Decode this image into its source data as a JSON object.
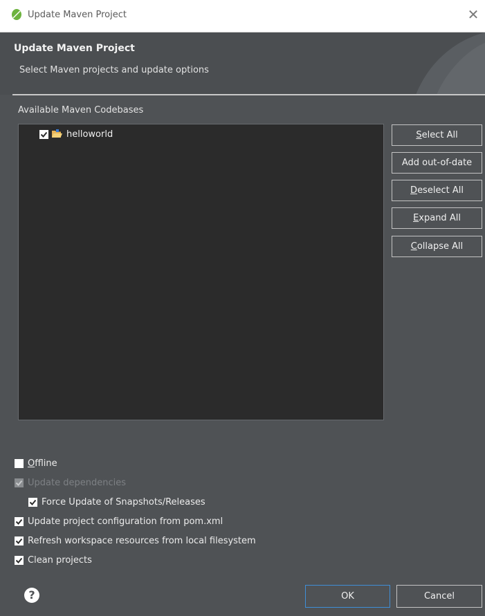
{
  "window": {
    "title": "Update Maven Project",
    "close_glyph": "✕"
  },
  "header": {
    "title": "Update Maven Project",
    "subtitle": "Select Maven projects and update options"
  },
  "codebases": {
    "label": "Available Maven Codebases",
    "items": [
      {
        "label": "helloworld",
        "checked": true
      }
    ]
  },
  "side_buttons": {
    "select_all": {
      "mnemonic": "S",
      "rest": "elect All"
    },
    "add_out_of_date": {
      "label": "Add out-of-date"
    },
    "deselect_all": {
      "mnemonic": "D",
      "rest": "eselect All"
    },
    "expand_all": {
      "mnemonic": "E",
      "rest": "xpand All"
    },
    "collapse_all": {
      "mnemonic": "C",
      "rest": "ollapse All"
    }
  },
  "options": {
    "offline": {
      "mnemonic": "O",
      "rest": "ffline",
      "checked": false
    },
    "update_dependencies": {
      "label": "Update dependencies",
      "checked": true,
      "disabled": true
    },
    "force_update": {
      "label": "Force Update of Snapshots/Releases",
      "checked": true
    },
    "update_config": {
      "label": "Update project configuration from pom.xml",
      "checked": true
    },
    "refresh_workspace": {
      "label": "Refresh workspace resources from local filesystem",
      "checked": true
    },
    "clean_projects": {
      "label": "Clean projects",
      "checked": true
    }
  },
  "footer": {
    "help_glyph": "?",
    "ok_label": "OK",
    "cancel_label": "Cancel"
  },
  "colors": {
    "dialog_bg": "#4f5255",
    "tree_bg": "#2b2b2b",
    "default_button_border": "#3f8fd8"
  }
}
